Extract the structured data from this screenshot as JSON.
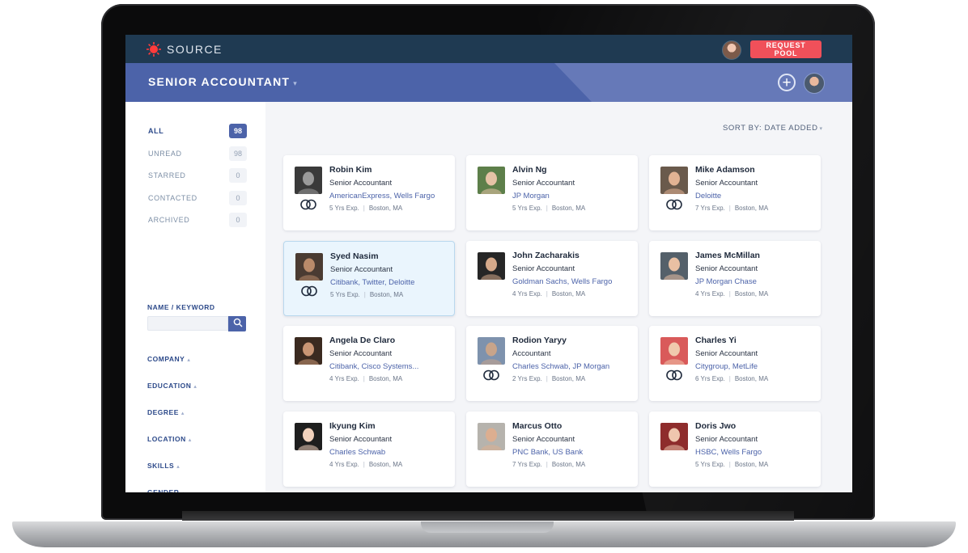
{
  "app": {
    "brand": "SOURCE",
    "request_label": "REQUEST POOL"
  },
  "header": {
    "job_title": "SENIOR ACCOUNTANT"
  },
  "filters": [
    {
      "label": "ALL",
      "count": "98",
      "active": true
    },
    {
      "label": "UNREAD",
      "count": "98",
      "active": false
    },
    {
      "label": "STARRED",
      "count": "0",
      "active": false
    },
    {
      "label": "CONTACTED",
      "count": "0",
      "active": false
    },
    {
      "label": "ARCHIVED",
      "count": "0",
      "active": false
    }
  ],
  "keyword": {
    "label": "NAME / KEYWORD",
    "value": ""
  },
  "facets": [
    "COMPANY",
    "EDUCATION",
    "DEGREE",
    "LOCATION",
    "SKILLS",
    "GENDER"
  ],
  "sort": {
    "label": "SORT BY:",
    "value": "DATE ADDED"
  },
  "candidates": [
    {
      "name": "Robin Kim",
      "title": "Senior Accountant",
      "companies": "AmericanExpress, Wells Fargo",
      "exp": "5 Yrs Exp.",
      "location": "Boston, MA",
      "rings": true,
      "selected": false,
      "photo": [
        "#3a3a3a",
        "#9a9a9a"
      ]
    },
    {
      "name": "Alvin Ng",
      "title": "Senior Accountant",
      "companies": "JP Morgan",
      "exp": "5 Yrs Exp.",
      "location": "Boston, MA",
      "rings": false,
      "selected": false,
      "photo": [
        "#5d7f4a",
        "#e6c3a6"
      ]
    },
    {
      "name": "Mike Adamson",
      "title": "Senior Accountant",
      "companies": "Deloitte",
      "exp": "7 Yrs Exp.",
      "location": "Boston, MA",
      "rings": true,
      "selected": false,
      "photo": [
        "#6a5a4c",
        "#e2b394"
      ]
    },
    {
      "name": "Syed Nasim",
      "title": "Senior Accountant",
      "companies": "Citibank, Twitter, Deloitte",
      "exp": "5 Yrs Exp.",
      "location": "Boston, MA",
      "rings": true,
      "selected": true,
      "photo": [
        "#4a3b32",
        "#b98a6a"
      ]
    },
    {
      "name": "John Zacharakis",
      "title": "Senior Accountant",
      "companies": "Goldman Sachs, Wells Fargo",
      "exp": "4 Yrs Exp.",
      "location": "Boston, MA",
      "rings": false,
      "selected": false,
      "photo": [
        "#262626",
        "#d6a98a"
      ]
    },
    {
      "name": "James McMillan",
      "title": "Senior Accountant",
      "companies": "JP Morgan Chase",
      "exp": "4 Yrs Exp.",
      "location": "Boston, MA",
      "rings": false,
      "selected": false,
      "photo": [
        "#54606a",
        "#e9c0a3"
      ]
    },
    {
      "name": "Angela De Claro",
      "title": "Senior Accountant",
      "companies": "Citibank, Cisco Systems...",
      "exp": "4 Yrs Exp.",
      "location": "Boston, MA",
      "rings": false,
      "selected": false,
      "photo": [
        "#3b2a20",
        "#c99574"
      ]
    },
    {
      "name": "Rodion Yaryy",
      "title": "Accountant",
      "companies": "Charles Schwab, JP Morgan",
      "exp": "2 Yrs Exp.",
      "location": "Boston, MA",
      "rings": true,
      "selected": false,
      "photo": [
        "#7e92ad",
        "#c8a48a"
      ]
    },
    {
      "name": "Charles Yi",
      "title": "Senior Accountant",
      "companies": "Citygroup, MetLife",
      "exp": "6 Yrs Exp.",
      "location": "Boston, MA",
      "rings": true,
      "selected": false,
      "photo": [
        "#d95a5a",
        "#f0c9ad"
      ]
    },
    {
      "name": "Ikyung Kim",
      "title": "Senior Accountant",
      "companies": "Charles Schwab",
      "exp": "4 Yrs Exp.",
      "location": "Boston, MA",
      "rings": false,
      "selected": false,
      "photo": [
        "#1e1e1e",
        "#f2d2bd"
      ]
    },
    {
      "name": "Marcus Otto",
      "title": "Senior Accountant",
      "companies": "PNC Bank, US Bank",
      "exp": "7 Yrs Exp.",
      "location": "Boston, MA",
      "rings": false,
      "selected": false,
      "photo": [
        "#b6b3ad",
        "#dcae90"
      ]
    },
    {
      "name": "Doris Jwo",
      "title": "Senior Accountant",
      "companies": "HSBC, Wells Fargo",
      "exp": "5 Yrs Exp.",
      "location": "Boston, MA",
      "rings": false,
      "selected": false,
      "photo": [
        "#8e2c2c",
        "#efc6ae"
      ]
    }
  ]
}
